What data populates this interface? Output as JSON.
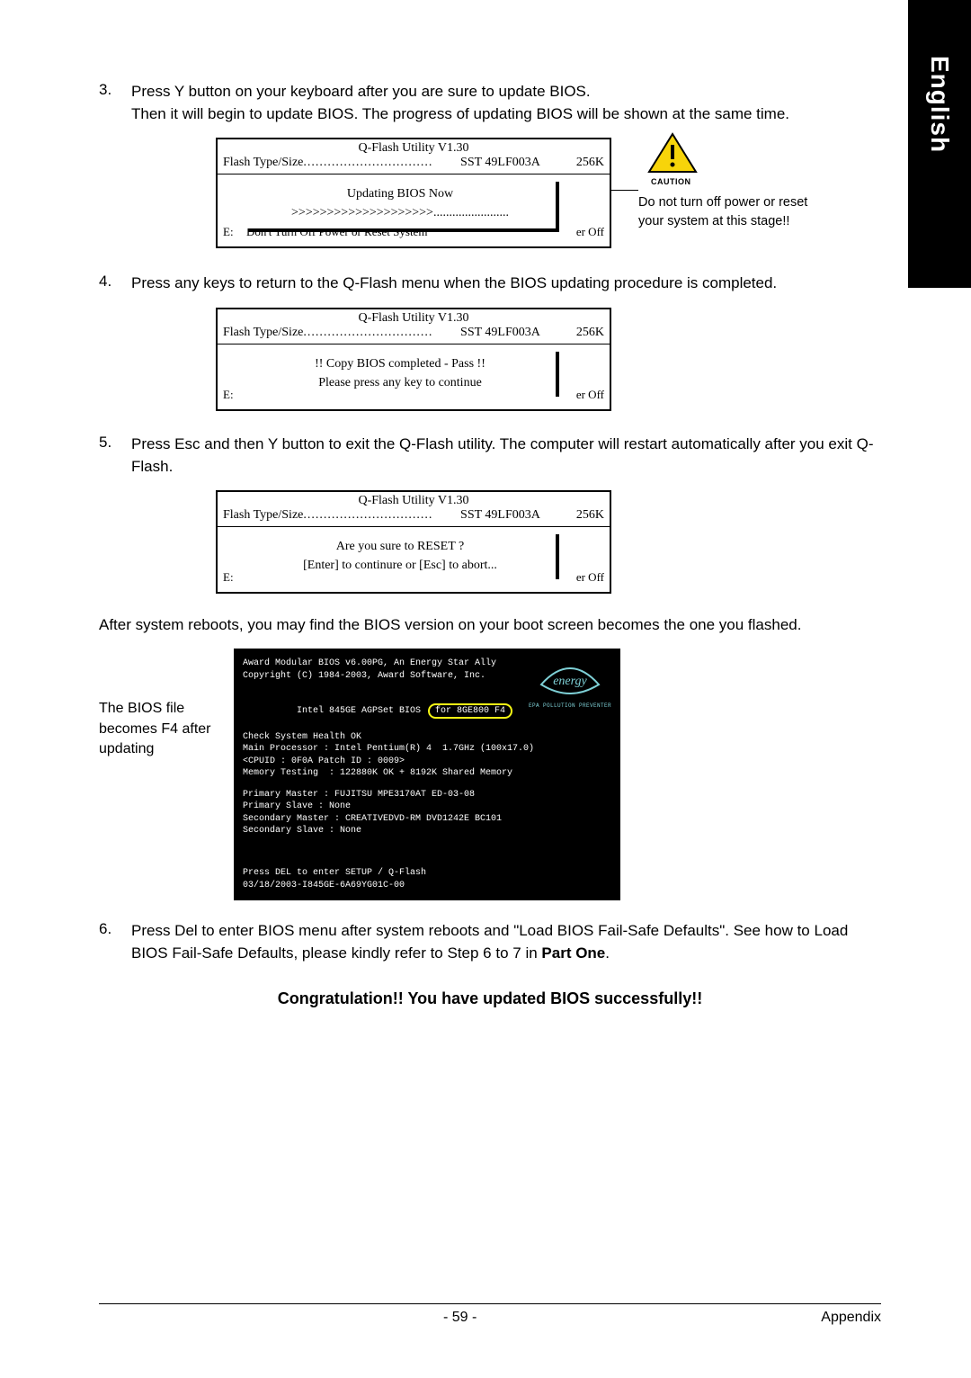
{
  "language_tab": "English",
  "steps": {
    "s3": {
      "num": "3.",
      "text_a": "Press Y button on your keyboard after you are sure to update BIOS.",
      "text_b": "Then it will begin to update BIOS. The progress of updating BIOS will be shown at the same time."
    },
    "s4": {
      "num": "4.",
      "text": "Press any keys to return to the Q-Flash menu when the BIOS updating procedure is completed."
    },
    "s5": {
      "num": "5.",
      "text": "Press Esc and then Y button to exit the Q-Flash utility. The computer will restart automatically after you exit Q-Flash."
    },
    "s6": {
      "num": "6.",
      "text_a": "Press Del to enter BIOS menu after system reboots and \"Load BIOS Fail-Safe Defaults\". See how to Load BIOS Fail-Safe Defaults, please kindly refer to Step 6 to 7 in ",
      "text_b": "Part One",
      "text_c": "."
    }
  },
  "bios_common": {
    "title": "Q-Flash Utility V1.30",
    "flash_label": "Flash Type/Size",
    "flash_value": "SST 49LF003A",
    "flash_size": "256K",
    "left_e": "E:",
    "right_off": "er Off"
  },
  "bios1": {
    "line1": "Updating BIOS Now",
    "line2": ">>>>>>>>>>>>>>>>>>>>........................",
    "warn": "Don't Turn Off Power or Reset System"
  },
  "bios2": {
    "line1": "!! Copy BIOS completed - Pass !!",
    "line2": "Please press any key to continue"
  },
  "bios3": {
    "line1": "Are you sure to RESET ?",
    "line2": "[Enter] to continure or [Esc] to abort..."
  },
  "caution": {
    "label": "CAUTION",
    "text": "Do not turn off power or reset your system at this stage!!"
  },
  "after_reboot": "After system reboots, you may find the BIOS version on your boot screen becomes the one you flashed.",
  "boot_label": "The BIOS file becomes F4 after updating",
  "boot": {
    "l1": "Award Modular BIOS v6.00PG, An Energy Star Ally",
    "l2": "Copyright (C) 1984-2003, Award Software, Inc.",
    "l3a": "Intel 845GE AGPSet BIOS ",
    "l3b": "for 8GE800 F4",
    "l4": "Check System Health OK",
    "l5": "Main Processor : Intel Pentium(R) 4  1.7GHz (100x17.0)",
    "l6": "<CPUID : 0F0A Patch ID : 0009>",
    "l7": "Memory Testing  : 122880K OK + 8192K Shared Memory",
    "l8": "Primary Master : FUJITSU MPE3170AT ED-03-08",
    "l9": "Primary Slave : None",
    "l10": "Secondary Master : CREATIVEDVD-RM DVD1242E BC101",
    "l11": "Secondary Slave : None",
    "b1": "Press DEL to enter SETUP / Q-Flash",
    "b2": "03/18/2003-I845GE-6A69YG01C-00",
    "epa": "EPA   POLLUTION PREVENTER"
  },
  "congrat": "Congratulation!! You have updated BIOS successfully!!",
  "footer": {
    "page": "- 59 -",
    "section": "Appendix"
  }
}
